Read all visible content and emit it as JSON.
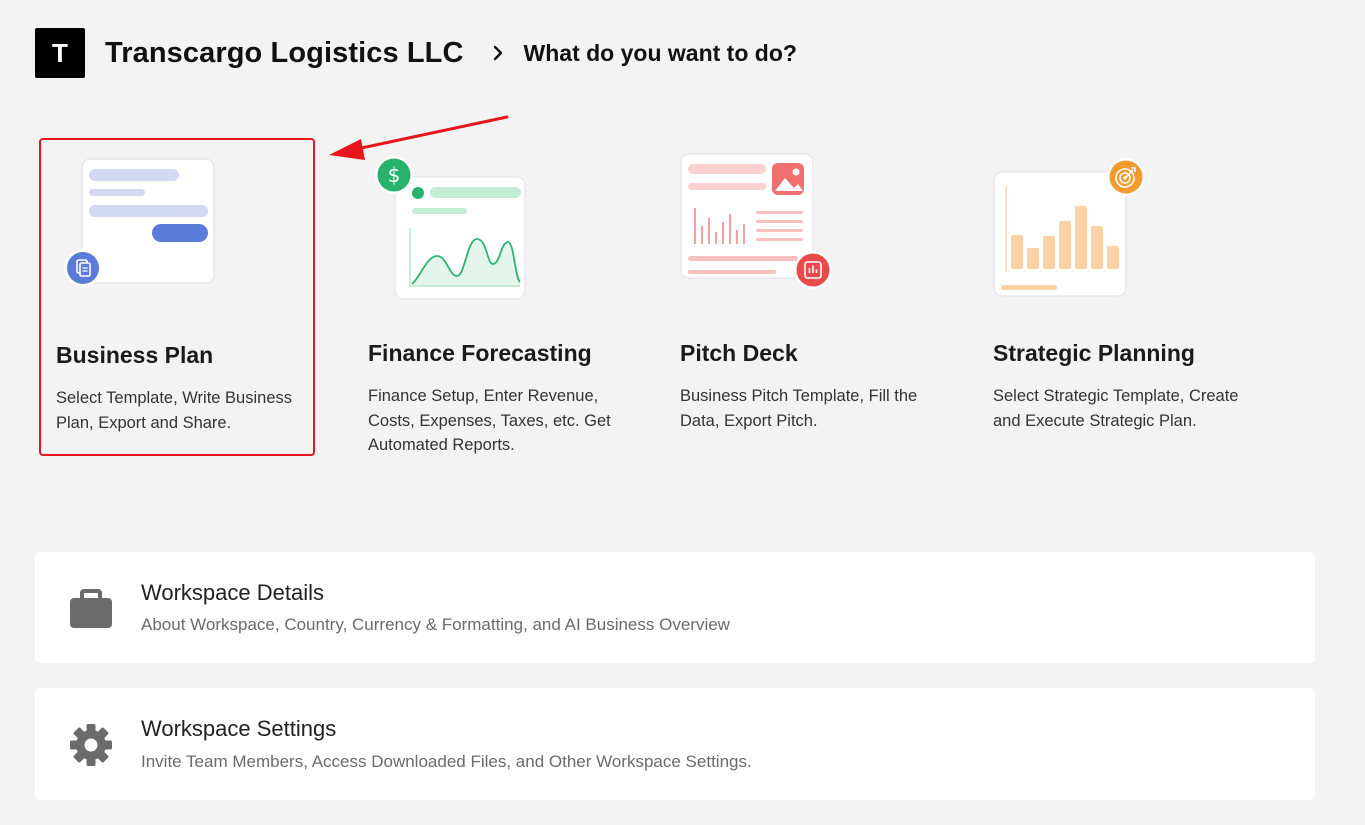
{
  "header": {
    "logo_letter": "T",
    "company_name": "Transcargo Logistics LLC",
    "question": "What do you want to do?"
  },
  "cards": [
    {
      "title": "Business Plan",
      "description": "Select Template, Write Business Plan, Export and Share."
    },
    {
      "title": "Finance Forecasting",
      "description": "Finance Setup, Enter Revenue, Costs, Expenses, Taxes, etc. Get Automated Reports."
    },
    {
      "title": "Pitch Deck",
      "description": "Business Pitch Template, Fill the Data, Export Pitch."
    },
    {
      "title": "Strategic Planning",
      "description": "Select Strategic Template, Create and Execute Strategic Plan."
    }
  ],
  "panels": [
    {
      "title": "Workspace Details",
      "description": "About Workspace, Country, Currency & Formatting, and AI Business Overview",
      "icon": "briefcase-icon"
    },
    {
      "title": "Workspace Settings",
      "description": "Invite Team Members, Access Downloaded Files, and Other Workspace Settings.",
      "icon": "gear-icon"
    }
  ],
  "colors": {
    "background": "#f2f3f2",
    "highlight": "#e8161b",
    "business_plan_accent": "#5b7bd8",
    "finance_accent": "#27b36b",
    "pitch_accent": "#e84b4b",
    "strategic_accent": "#f29a2e"
  }
}
